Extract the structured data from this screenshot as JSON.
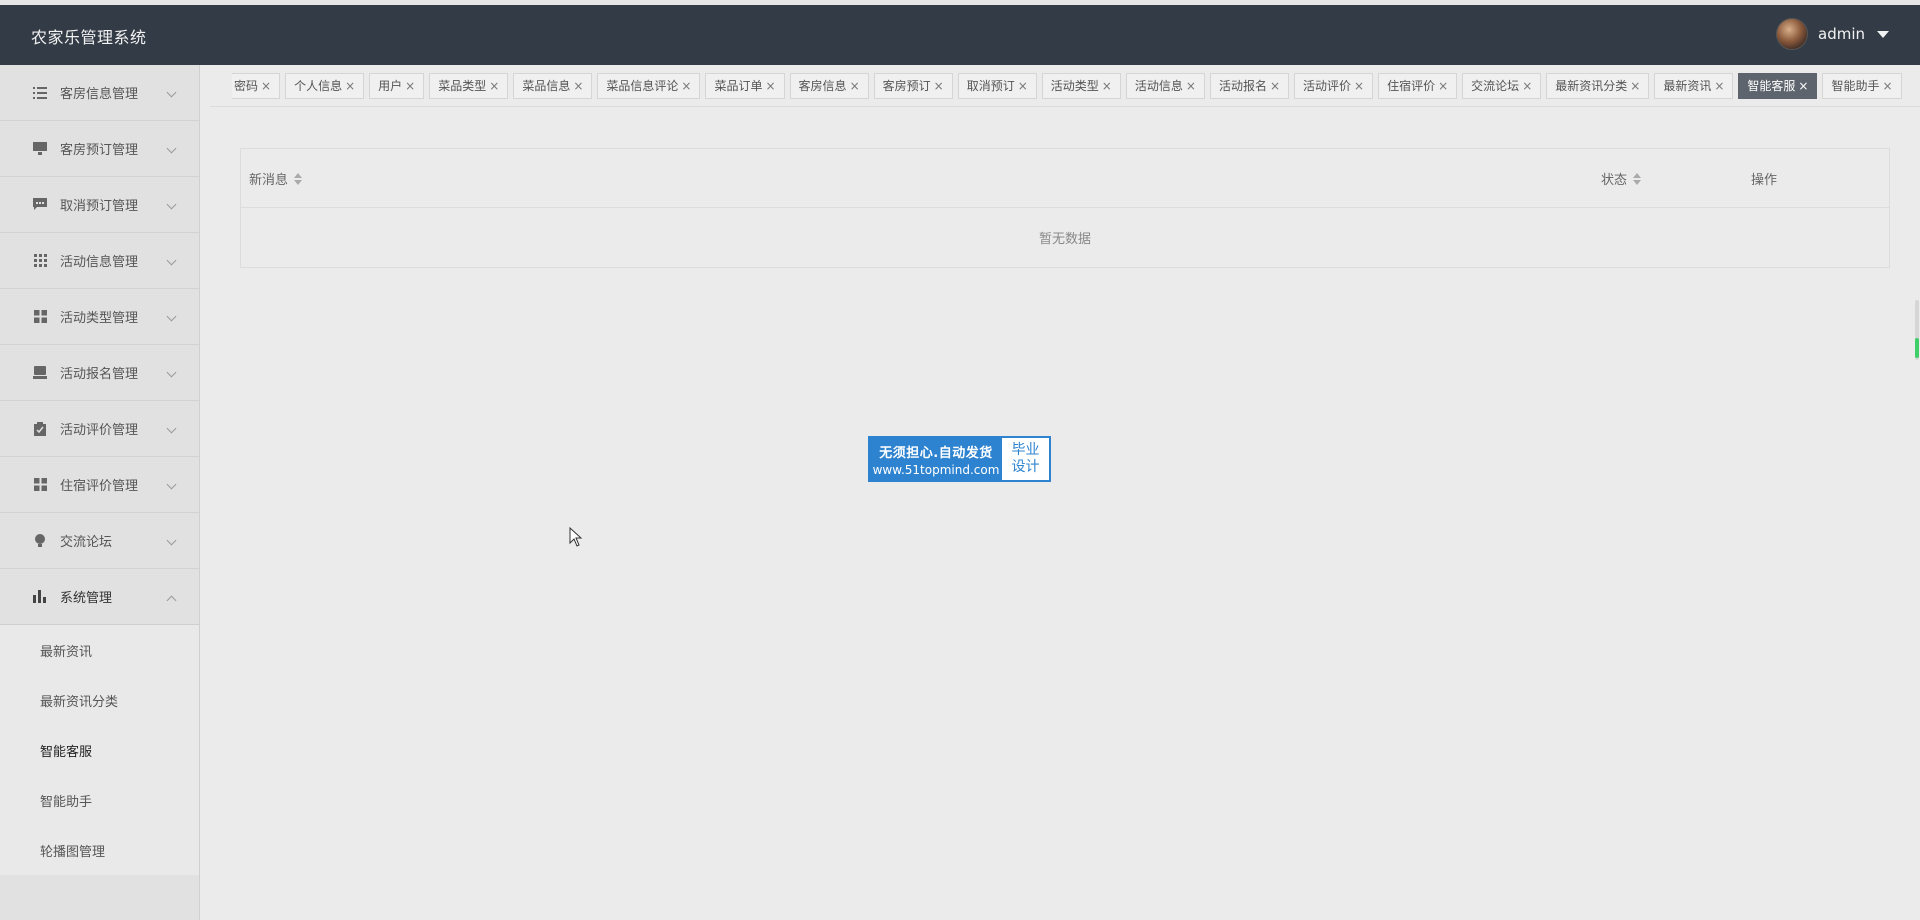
{
  "header": {
    "brand": "农家乐管理系统",
    "user_name": "admin"
  },
  "sidebar": {
    "items": [
      {
        "label": "客房信息管理",
        "icon": "list-icon"
      },
      {
        "label": "客房预订管理",
        "icon": "monitor-icon"
      },
      {
        "label": "取消预订管理",
        "icon": "chat-icon"
      },
      {
        "label": "活动信息管理",
        "icon": "grid-icon"
      },
      {
        "label": "活动类型管理",
        "icon": "apps-icon"
      },
      {
        "label": "活动报名管理",
        "icon": "tray-icon"
      },
      {
        "label": "活动评价管理",
        "icon": "clipboard-icon"
      },
      {
        "label": "住宿评价管理",
        "icon": "apps-icon"
      },
      {
        "label": "交流论坛",
        "icon": "bulb-icon"
      },
      {
        "label": "系统管理",
        "icon": "bar-chart-icon"
      }
    ],
    "submenu": [
      {
        "label": "最新资讯"
      },
      {
        "label": "最新资讯分类"
      },
      {
        "label": "智能客服"
      },
      {
        "label": "智能助手"
      },
      {
        "label": "轮播图管理"
      }
    ]
  },
  "tabs": [
    {
      "label": "密码"
    },
    {
      "label": "个人信息"
    },
    {
      "label": "用户"
    },
    {
      "label": "菜品类型"
    },
    {
      "label": "菜品信息"
    },
    {
      "label": "菜品信息评论"
    },
    {
      "label": "菜品订单"
    },
    {
      "label": "客房信息"
    },
    {
      "label": "客房预订"
    },
    {
      "label": "取消预订"
    },
    {
      "label": "活动类型"
    },
    {
      "label": "活动信息"
    },
    {
      "label": "活动报名"
    },
    {
      "label": "活动评价"
    },
    {
      "label": "住宿评价"
    },
    {
      "label": "交流论坛"
    },
    {
      "label": "最新资讯分类"
    },
    {
      "label": "最新资讯"
    },
    {
      "label": "智能客服"
    },
    {
      "label": "智能助手"
    }
  ],
  "tab_close": "×",
  "table": {
    "columns": [
      "新消息",
      "状态",
      "操作"
    ],
    "empty_text": "暂无数据"
  },
  "watermark": {
    "line1": "无须担心.自动发货",
    "line2": "www.51topmind.com",
    "right1": "毕业",
    "right2": "设计"
  },
  "colors": {
    "header_bg": "#333b46",
    "active_tab": "#5d646d",
    "badge_blue": "#2e83d0"
  }
}
